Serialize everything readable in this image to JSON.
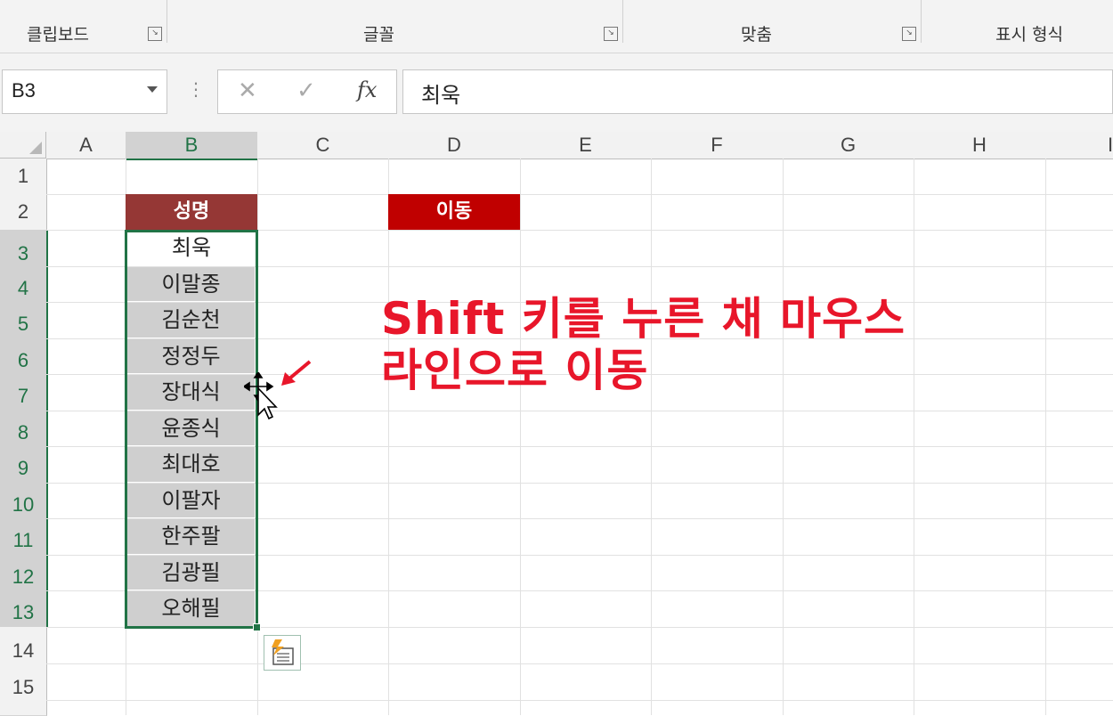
{
  "ribbon": {
    "groups": [
      {
        "label": "클립보드"
      },
      {
        "label": "글꼴"
      },
      {
        "label": "맞춤"
      },
      {
        "label": "표시 형식"
      }
    ]
  },
  "formula_bar": {
    "name_box": "B3",
    "cancel_icon": "✕",
    "enter_icon": "✓",
    "fx_label": "fx",
    "formula_value": "최욱"
  },
  "grid": {
    "columns": [
      "A",
      "B",
      "C",
      "D",
      "E",
      "F",
      "G",
      "H",
      "I"
    ],
    "rows": [
      "1",
      "2",
      "3",
      "4",
      "5",
      "6",
      "7",
      "8",
      "9",
      "10",
      "11",
      "12",
      "13",
      "14",
      "15"
    ],
    "selected_column": "B",
    "selected_rows": [
      "3",
      "4",
      "5",
      "6",
      "7",
      "8",
      "9",
      "10",
      "11",
      "12",
      "13"
    ]
  },
  "cells": {
    "B2": "성명",
    "D2": "이동",
    "B3": "최욱",
    "names": [
      "이말종",
      "김순천",
      "정정두",
      "장대식",
      "윤종식",
      "최대호",
      "이팔자",
      "한주팔",
      "김광필",
      "오해필"
    ]
  },
  "annotation": {
    "line1": "Shift 키를 누른 채 마우스",
    "line2": "라인으로 이동"
  },
  "colors": {
    "header_b2": "#953735",
    "header_d2": "#c00000",
    "selection": "#217346",
    "annotation": "#e8162a",
    "name_fill": "#cfcfcf"
  },
  "icons": {
    "move_cursor": "move-cursor-icon",
    "arrow": "red-arrow-icon",
    "paste_options": "paste-options-icon"
  }
}
